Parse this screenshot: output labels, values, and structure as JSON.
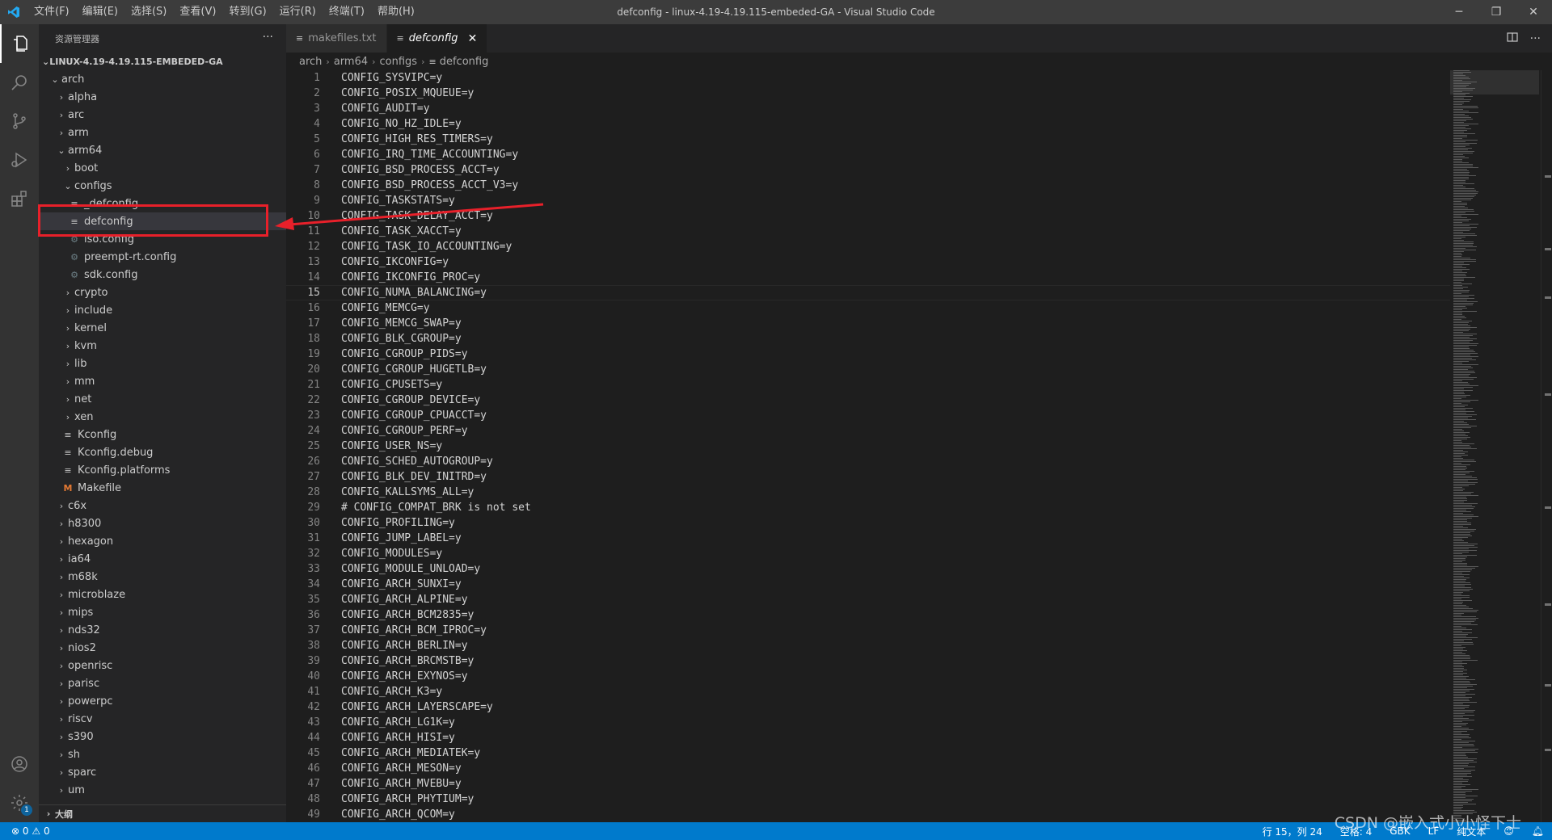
{
  "titlebar": {
    "menus": [
      "文件(F)",
      "编辑(E)",
      "选择(S)",
      "查看(V)",
      "转到(G)",
      "运行(R)",
      "终端(T)",
      "帮助(H)"
    ],
    "window_title": "defconfig - linux-4.19-4.19.115-embeded-GA - Visual Studio Code",
    "minimize": "─",
    "restore": "❐",
    "close": "✕"
  },
  "sidebar": {
    "title": "资源管理器",
    "more": "···",
    "root": "LINUX-4.19-4.19.115-EMBEDED-GA",
    "tree": [
      {
        "label": "arch",
        "depth": 1,
        "kind": "folder-open"
      },
      {
        "label": "alpha",
        "depth": 2,
        "kind": "folder"
      },
      {
        "label": "arc",
        "depth": 2,
        "kind": "folder"
      },
      {
        "label": "arm",
        "depth": 2,
        "kind": "folder"
      },
      {
        "label": "arm64",
        "depth": 2,
        "kind": "folder-open"
      },
      {
        "label": "boot",
        "depth": 3,
        "kind": "folder"
      },
      {
        "label": "configs",
        "depth": 3,
        "kind": "folder-open"
      },
      {
        "label": "_defconfig",
        "depth": 4,
        "kind": "file"
      },
      {
        "label": "defconfig",
        "depth": 4,
        "kind": "file",
        "selected": true
      },
      {
        "label": "iso.config",
        "depth": 4,
        "kind": "config"
      },
      {
        "label": "preempt-rt.config",
        "depth": 4,
        "kind": "config"
      },
      {
        "label": "sdk.config",
        "depth": 4,
        "kind": "config"
      },
      {
        "label": "crypto",
        "depth": 3,
        "kind": "folder"
      },
      {
        "label": "include",
        "depth": 3,
        "kind": "folder"
      },
      {
        "label": "kernel",
        "depth": 3,
        "kind": "folder"
      },
      {
        "label": "kvm",
        "depth": 3,
        "kind": "folder"
      },
      {
        "label": "lib",
        "depth": 3,
        "kind": "folder"
      },
      {
        "label": "mm",
        "depth": 3,
        "kind": "folder"
      },
      {
        "label": "net",
        "depth": 3,
        "kind": "folder"
      },
      {
        "label": "xen",
        "depth": 3,
        "kind": "folder"
      },
      {
        "label": "Kconfig",
        "depth": 3,
        "kind": "file"
      },
      {
        "label": "Kconfig.debug",
        "depth": 3,
        "kind": "file"
      },
      {
        "label": "Kconfig.platforms",
        "depth": 3,
        "kind": "file"
      },
      {
        "label": "Makefile",
        "depth": 3,
        "kind": "makefile"
      },
      {
        "label": "c6x",
        "depth": 2,
        "kind": "folder"
      },
      {
        "label": "h8300",
        "depth": 2,
        "kind": "folder"
      },
      {
        "label": "hexagon",
        "depth": 2,
        "kind": "folder"
      },
      {
        "label": "ia64",
        "depth": 2,
        "kind": "folder"
      },
      {
        "label": "m68k",
        "depth": 2,
        "kind": "folder"
      },
      {
        "label": "microblaze",
        "depth": 2,
        "kind": "folder"
      },
      {
        "label": "mips",
        "depth": 2,
        "kind": "folder"
      },
      {
        "label": "nds32",
        "depth": 2,
        "kind": "folder"
      },
      {
        "label": "nios2",
        "depth": 2,
        "kind": "folder"
      },
      {
        "label": "openrisc",
        "depth": 2,
        "kind": "folder"
      },
      {
        "label": "parisc",
        "depth": 2,
        "kind": "folder"
      },
      {
        "label": "powerpc",
        "depth": 2,
        "kind": "folder"
      },
      {
        "label": "riscv",
        "depth": 2,
        "kind": "folder"
      },
      {
        "label": "s390",
        "depth": 2,
        "kind": "folder"
      },
      {
        "label": "sh",
        "depth": 2,
        "kind": "folder"
      },
      {
        "label": "sparc",
        "depth": 2,
        "kind": "folder"
      },
      {
        "label": "um",
        "depth": 2,
        "kind": "folder"
      }
    ],
    "outline": "大纲"
  },
  "tabs": [
    {
      "label": "makefiles.txt",
      "active": false
    },
    {
      "label": "defconfig",
      "active": true
    }
  ],
  "tab_close": "✕",
  "breadcrumb": [
    "arch",
    "arm64",
    "configs",
    "defconfig"
  ],
  "editor": {
    "current_line": 15,
    "lines": [
      "CONFIG_SYSVIPC=y",
      "CONFIG_POSIX_MQUEUE=y",
      "CONFIG_AUDIT=y",
      "CONFIG_NO_HZ_IDLE=y",
      "CONFIG_HIGH_RES_TIMERS=y",
      "CONFIG_IRQ_TIME_ACCOUNTING=y",
      "CONFIG_BSD_PROCESS_ACCT=y",
      "CONFIG_BSD_PROCESS_ACCT_V3=y",
      "CONFIG_TASKSTATS=y",
      "CONFIG_TASK_DELAY_ACCT=y",
      "CONFIG_TASK_XACCT=y",
      "CONFIG_TASK_IO_ACCOUNTING=y",
      "CONFIG_IKCONFIG=y",
      "CONFIG_IKCONFIG_PROC=y",
      "CONFIG_NUMA_BALANCING=y",
      "CONFIG_MEMCG=y",
      "CONFIG_MEMCG_SWAP=y",
      "CONFIG_BLK_CGROUP=y",
      "CONFIG_CGROUP_PIDS=y",
      "CONFIG_CGROUP_HUGETLB=y",
      "CONFIG_CPUSETS=y",
      "CONFIG_CGROUP_DEVICE=y",
      "CONFIG_CGROUP_CPUACCT=y",
      "CONFIG_CGROUP_PERF=y",
      "CONFIG_USER_NS=y",
      "CONFIG_SCHED_AUTOGROUP=y",
      "CONFIG_BLK_DEV_INITRD=y",
      "CONFIG_KALLSYMS_ALL=y",
      "# CONFIG_COMPAT_BRK is not set",
      "CONFIG_PROFILING=y",
      "CONFIG_JUMP_LABEL=y",
      "CONFIG_MODULES=y",
      "CONFIG_MODULE_UNLOAD=y",
      "CONFIG_ARCH_SUNXI=y",
      "CONFIG_ARCH_ALPINE=y",
      "CONFIG_ARCH_BCM2835=y",
      "CONFIG_ARCH_BCM_IPROC=y",
      "CONFIG_ARCH_BERLIN=y",
      "CONFIG_ARCH_BRCMSTB=y",
      "CONFIG_ARCH_EXYNOS=y",
      "CONFIG_ARCH_K3=y",
      "CONFIG_ARCH_LAYERSCAPE=y",
      "CONFIG_ARCH_LG1K=y",
      "CONFIG_ARCH_HISI=y",
      "CONFIG_ARCH_MEDIATEK=y",
      "CONFIG_ARCH_MESON=y",
      "CONFIG_ARCH_MVEBU=y",
      "CONFIG_ARCH_PHYTIUM=y",
      "CONFIG_ARCH_QCOM=y"
    ]
  },
  "statusbar": {
    "errors": "0",
    "warnings": "0",
    "position": "行 15，列 24",
    "indent": "空格: 4",
    "encoding": "GBK",
    "eol": "LF",
    "language": "纯文本"
  },
  "watermark": "CSDN @嵌入式小小怪下士",
  "colors": {
    "accent": "#007acc",
    "highlight_box": "#e8202a"
  }
}
